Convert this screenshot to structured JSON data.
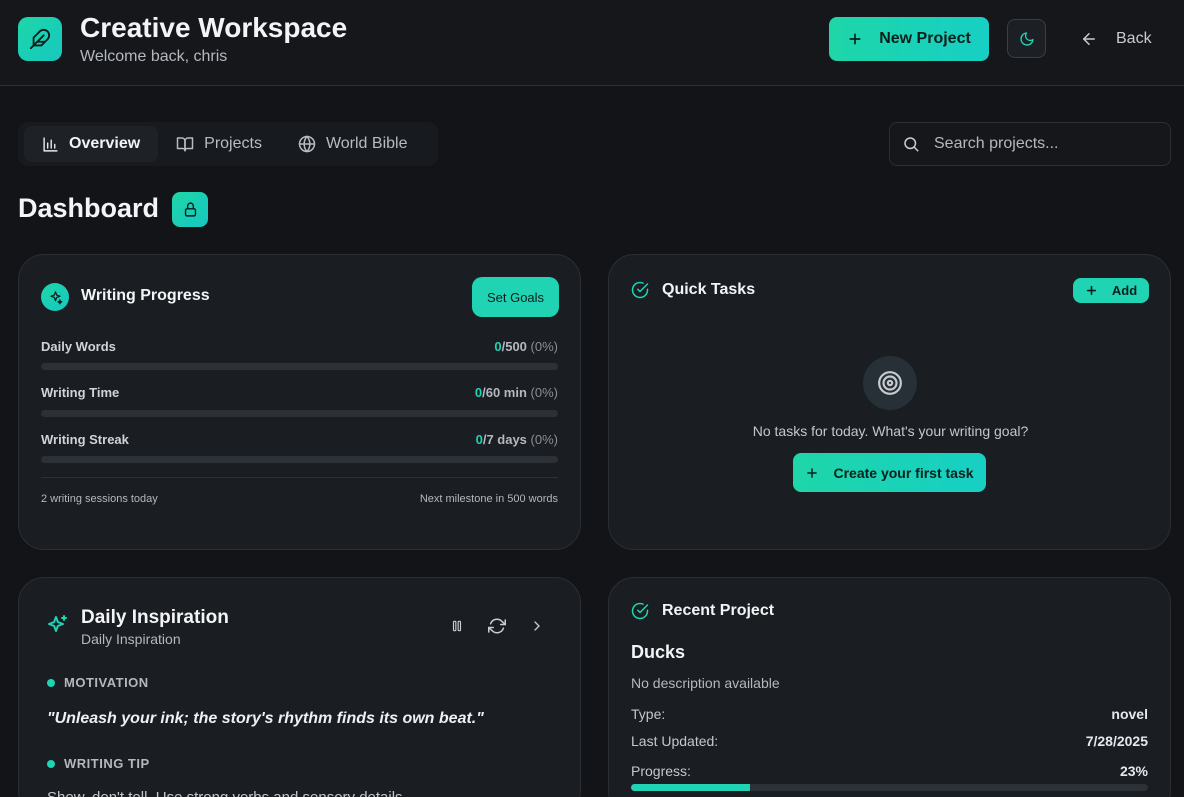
{
  "header": {
    "title": "Creative Workspace",
    "subtitle": "Welcome back, chris",
    "new_project_label": "New Project",
    "back_label": "Back"
  },
  "tabs": [
    {
      "label": "Overview",
      "active": true
    },
    {
      "label": "Projects",
      "active": false
    },
    {
      "label": "World Bible",
      "active": false
    }
  ],
  "search": {
    "placeholder": "Search projects..."
  },
  "dashboard": {
    "title": "Dashboard"
  },
  "writing_progress": {
    "title": "Writing Progress",
    "set_goals_label": "Set Goals",
    "metrics": [
      {
        "label": "Daily Words",
        "current": "0",
        "goal": "/500",
        "pct": "(0%)",
        "fraction": 0
      },
      {
        "label": "Writing Time",
        "current": "0",
        "goal": "/60 min",
        "pct": "(0%)",
        "fraction": 0
      },
      {
        "label": "Writing Streak",
        "current": "0",
        "goal": "/7 days",
        "pct": "(0%)",
        "fraction": 0
      }
    ],
    "sessions_text": "2 writing sessions today",
    "milestone_text": "Next milestone in 500 words"
  },
  "quick_tasks": {
    "title": "Quick Tasks",
    "add_label": "Add",
    "empty_text": "No tasks for today. What's your writing goal?",
    "create_label": "Create your first task"
  },
  "inspiration": {
    "title": "Daily Inspiration",
    "subtitle": "Daily Inspiration",
    "motivation_label": "MOTIVATION",
    "quote": "\"Unleash your ink; the story's rhythm finds its own beat.\"",
    "tip_label": "WRITING TIP",
    "tip": "Show, don't tell. Use strong verbs and sensory details."
  },
  "recent_project": {
    "title": "Recent Project",
    "name": "Ducks",
    "description": "No description available",
    "type_label": "Type:",
    "type_value": "novel",
    "updated_label": "Last Updated:",
    "updated_value": "7/28/2025",
    "progress_label": "Progress:",
    "progress_value": "23%",
    "progress_fraction": 0.23
  },
  "colors": {
    "accent": "#1fd3b3",
    "background": "#121418",
    "card": "#1a1d22"
  }
}
